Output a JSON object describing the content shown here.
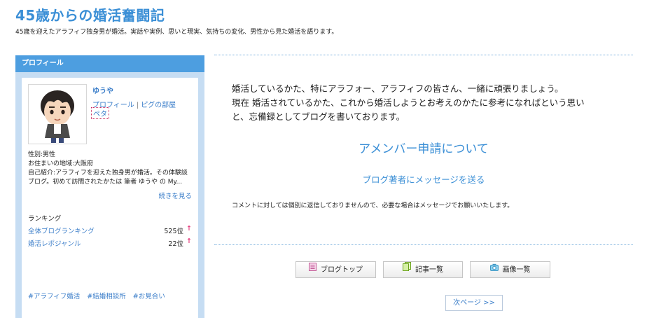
{
  "header": {
    "title": "45歳からの婚活奮闘記",
    "description": "45歳を迎えたアラフィフ独身男が婚活。実話や実例、思いと現実、気持ちの変化、男性から見た婚活を語ります。"
  },
  "profile": {
    "header": "プロフィール",
    "nickname": "ゆうや",
    "link_profile": "プロフィール",
    "separator": "|",
    "link_pig_room": "ピグの部屋",
    "peta": "ペタ",
    "gender": "性別:男性",
    "location": "お住まいの地域:大阪府",
    "intro": "自己紹介:アラフィフを迎えた独身男が婚活。その体験談ブログ。初めて訪問されたかたは 筆者 ゆうや の My...",
    "read_more": "続きを見る",
    "ranking_label": "ランキング",
    "rankings": [
      {
        "name": "全体ブログランキング",
        "value": "525位",
        "arrow": "↑"
      },
      {
        "name": "婚活レポジャンル",
        "value": "22位",
        "arrow": "↑"
      }
    ],
    "tags": [
      "#アラフィフ婚活",
      "#結婚相談所",
      "#お見合い"
    ]
  },
  "main": {
    "intro_lines": [
      "婚活しているかた、特にアラフォー、アラフィフの皆さん、一緒に頑張りましょう。",
      "現在 婚活されているかた、これから婚活しようとお考えのかたに参考になればという思い",
      "と、忘備録としてブログを書いております。"
    ],
    "amember_title": "アメンバー申請について",
    "message_link": "ブログ著者にメッセージを送る",
    "notice": "コメントに対しては個別に返信しておりませんので、必要な場合はメッセージでお願いいたします。",
    "nav": {
      "blog_top": "ブログトップ",
      "articles": "記事一覧",
      "images": "画像一覧",
      "next_page": "次ページ >>"
    }
  },
  "colors": {
    "accent": "#3b8fd6",
    "sidebar_header": "#4d9ee0",
    "sidebar_bg": "#c6ddf3",
    "rank_arrow": "#e4387a"
  }
}
